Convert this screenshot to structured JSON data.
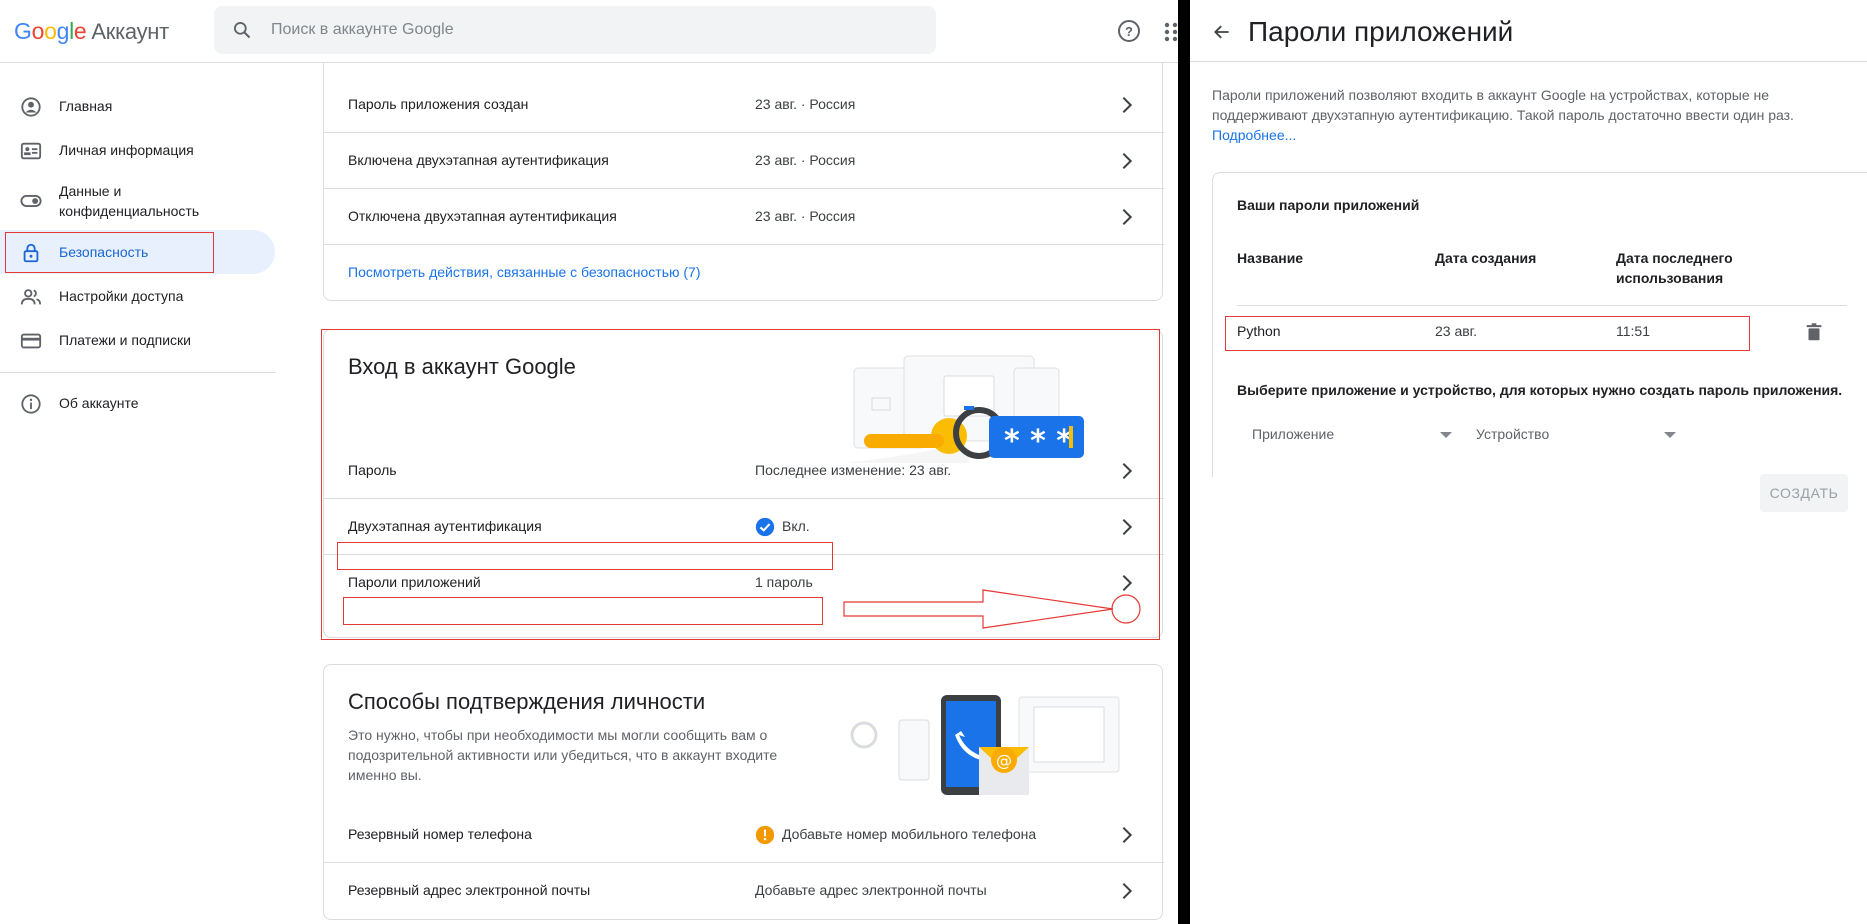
{
  "header": {
    "logo": {
      "g": "G",
      "o1": "o",
      "o2": "o",
      "g2": "g",
      "l": "l",
      "e": "e",
      "product": "Аккаунт"
    },
    "search_placeholder": "Поиск в аккаунте Google"
  },
  "sidebar": {
    "items": [
      {
        "label": "Главная",
        "icon": "home-icon"
      },
      {
        "label": "Личная информация",
        "icon": "id-card-icon"
      },
      {
        "label": "Данные и конфиденциальность",
        "icon": "toggle-icon"
      },
      {
        "label": "Безопасность",
        "icon": "lock-icon"
      },
      {
        "label": "Настройки доступа",
        "icon": "people-icon"
      },
      {
        "label": "Платежи и подписки",
        "icon": "credit-card-icon"
      },
      {
        "label": "Об аккаунте",
        "icon": "info-icon"
      }
    ]
  },
  "recent_activity": {
    "rows": [
      {
        "label": "Пароль приложения создан",
        "value": "23 авг. · Россия"
      },
      {
        "label": "Включена двухэтапная аутентификация",
        "value": "23 авг. · Россия"
      },
      {
        "label": "Отключена двухэтапная аутентификация",
        "value": "23 авг. · Россия"
      }
    ],
    "link": "Посмотреть действия, связанные с безопасностью (7)"
  },
  "signin": {
    "title": "Вход в аккаунт Google",
    "rows": [
      {
        "label": "Пароль",
        "value": "Последнее изменение: 23 авг."
      },
      {
        "label": "Двухэтапная аутентификация",
        "value": "Вкл."
      },
      {
        "label": "Пароли приложений",
        "value": "1 пароль"
      }
    ]
  },
  "verification": {
    "title": "Способы подтверждения личности",
    "description": "Это нужно, чтобы при необходимости мы могли сообщить вам о подозрительной активности или убедиться, что в аккаунт входите именно вы.",
    "rows": [
      {
        "label": "Резервный номер телефона",
        "value": "Добавьте номер мобильного телефона"
      },
      {
        "label": "Резервный адрес электронной почты",
        "value": "Добавьте адрес электронной почты"
      }
    ]
  },
  "app_passwords": {
    "title": "Пароли приложений",
    "description": "Пароли приложений позволяют входить в аккаунт Google на устройствах, которые не поддерживают двухэтапную аутентификацию. Такой пароль достаточно ввести один раз.",
    "more_link": "Подробнее...",
    "list_title": "Ваши пароли приложений",
    "columns": [
      "Название",
      "Дата создания",
      "Дата последнего использования"
    ],
    "rows": [
      {
        "name": "Python",
        "created": "23 авг.",
        "last_used": "11:51"
      }
    ],
    "select_prompt": "Выберите приложение и устройство, для которых нужно создать пароль приложения.",
    "app_select": "Приложение",
    "device_select": "Устройство",
    "create_button": "СОЗДАТЬ"
  },
  "colors": {
    "accent": "#1a73e8",
    "active_nav_bg": "#e8f0fe",
    "annotation_red": "#e53935",
    "warning": "#f29900"
  }
}
